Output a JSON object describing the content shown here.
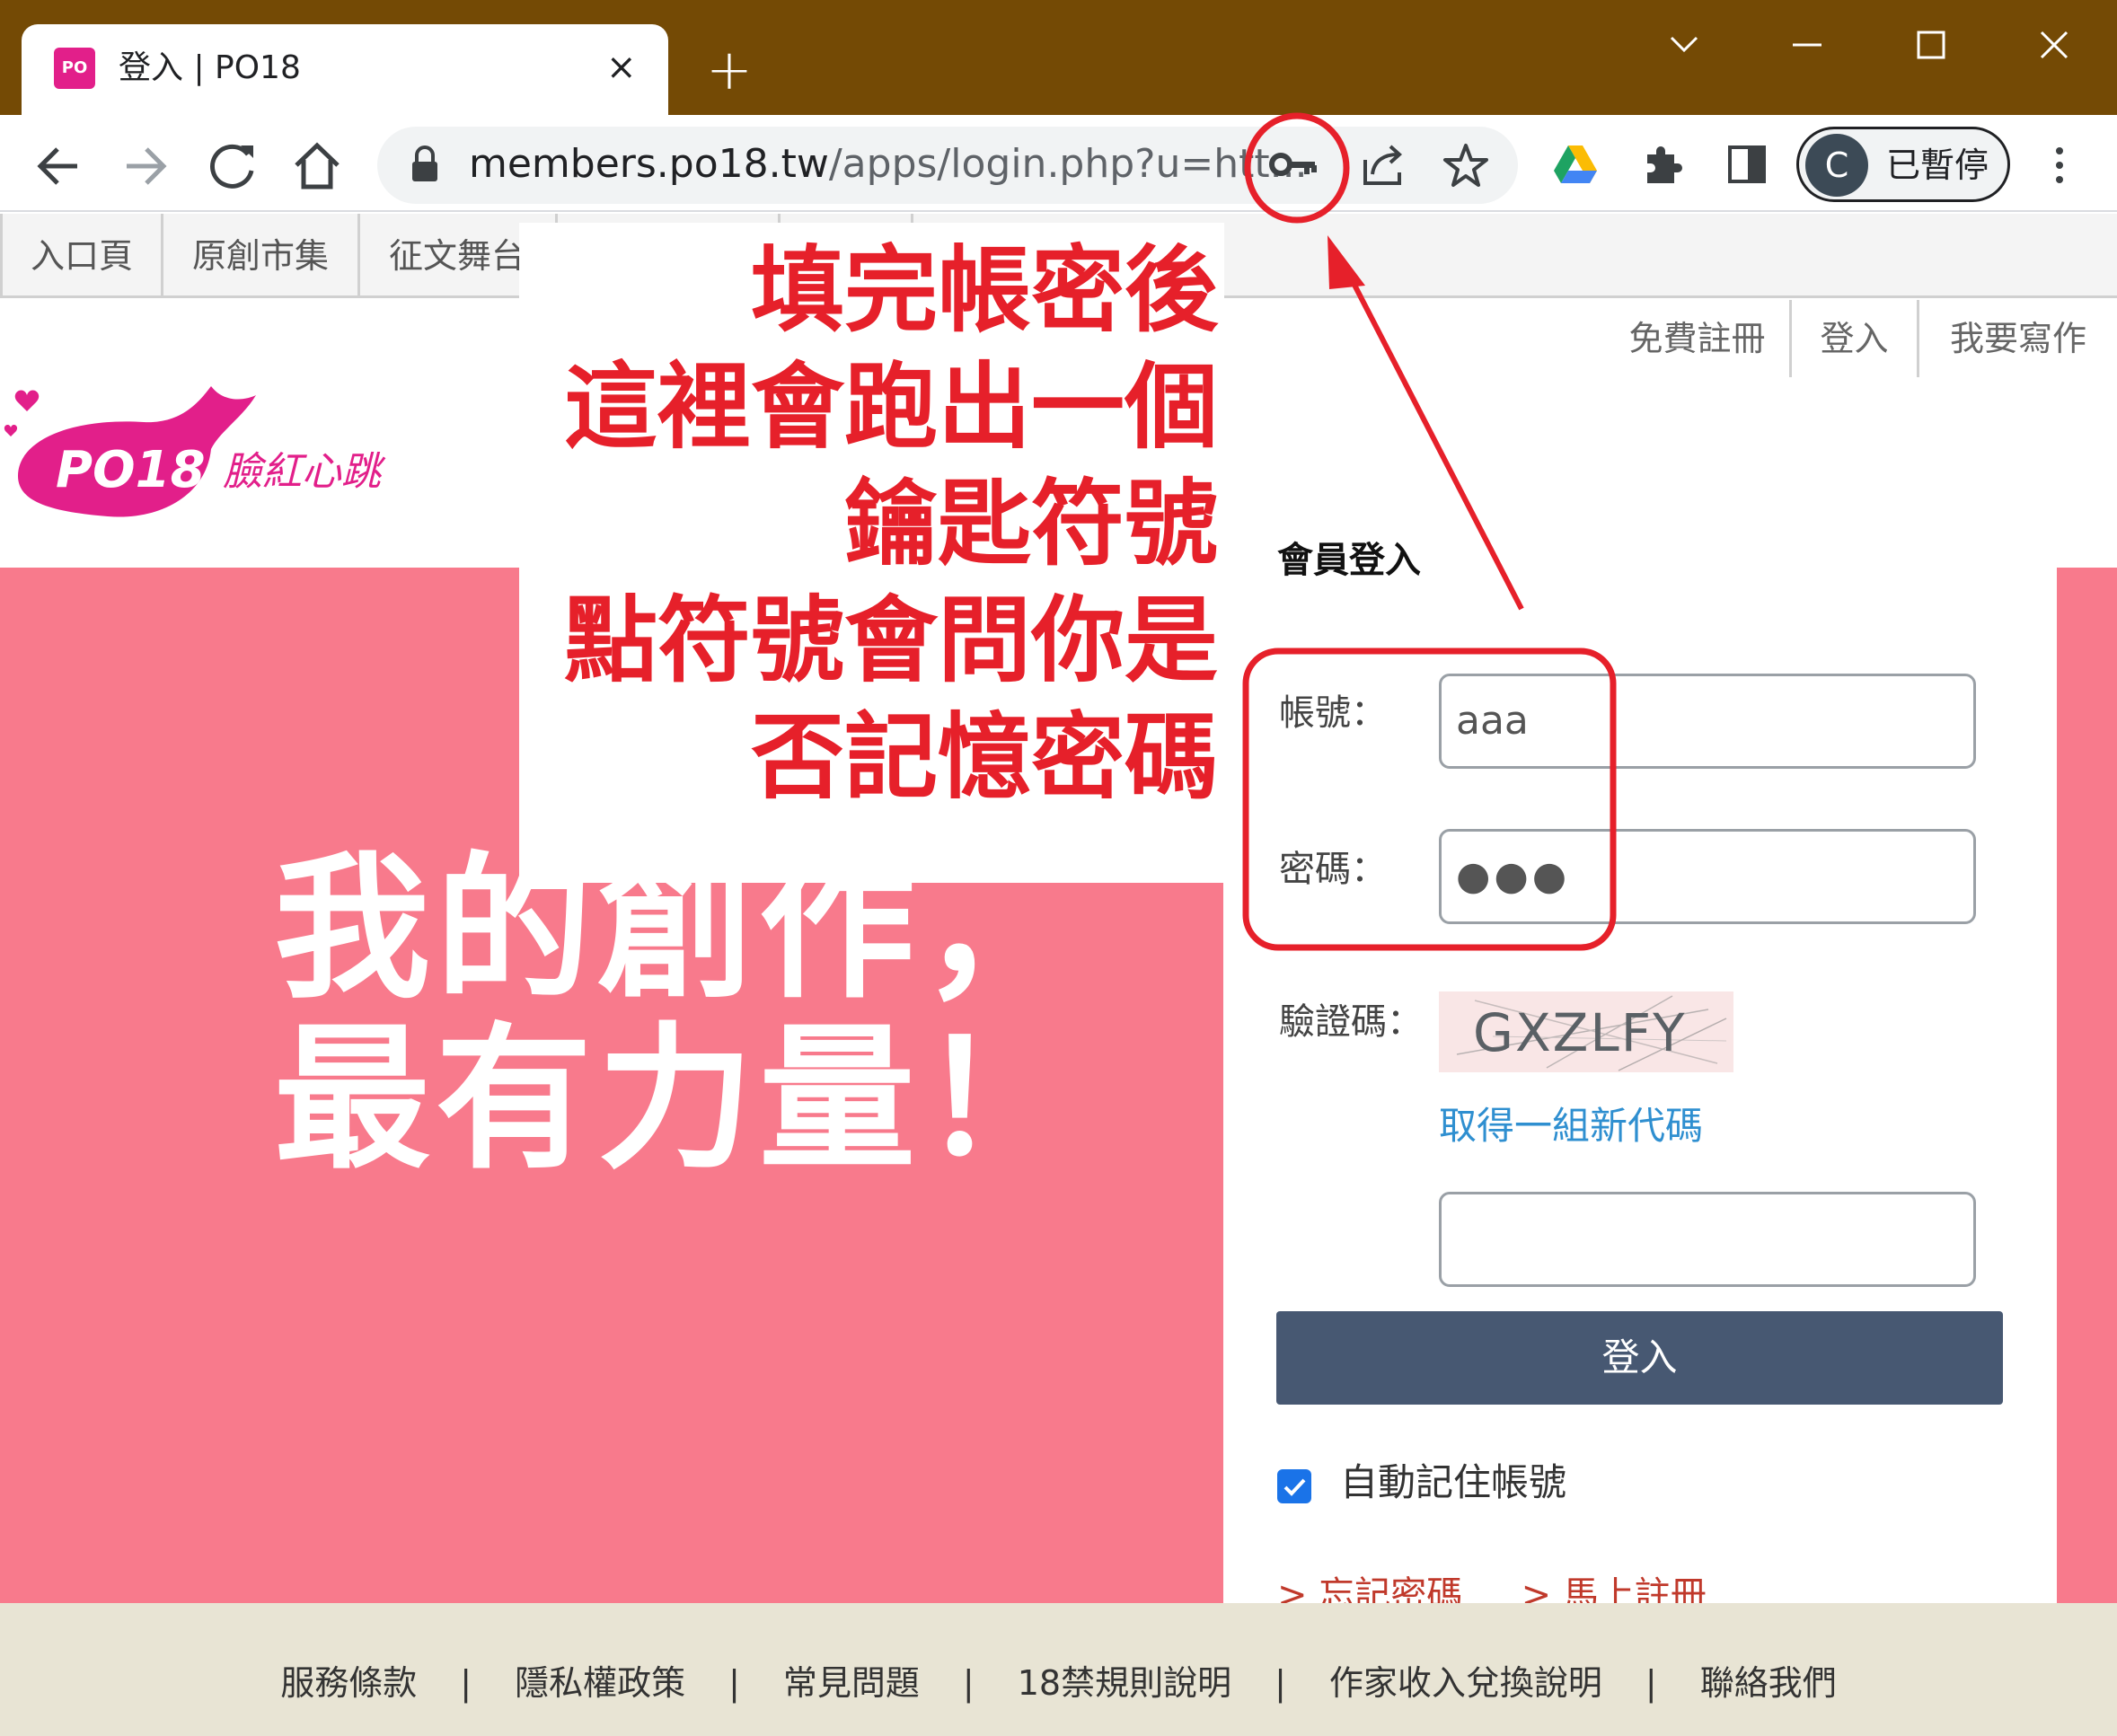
{
  "browser": {
    "tab_title": "登入 | PO18",
    "favicon_text": "PO",
    "tab_close": "×",
    "new_tab": "+",
    "url_host": "members.po18.tw",
    "url_rest": "/apps/login.php?u=htt...",
    "profile_initial": "C",
    "profile_status": "已暫停"
  },
  "site_nav": {
    "items": [
      {
        "label": "入口頁"
      },
      {
        "label": "原創市集"
      },
      {
        "label": "征文舞台"
      },
      {
        "label": ""
      },
      {
        "label": ""
      }
    ]
  },
  "header": {
    "register": "免費註冊",
    "login": "登入",
    "write": "我要寫作"
  },
  "logo": {
    "wordmark": "PO18",
    "tagline": "臉紅心跳"
  },
  "hero": {
    "line1": "我的創作，",
    "line2": "最有力量！"
  },
  "login_form": {
    "title": "會員登入",
    "account_label": "帳號：",
    "account_value": "aaa",
    "password_label": "密碼：",
    "password_value": "●●●",
    "captcha_label": "驗證碼：",
    "captcha_text": "GXZLFY",
    "new_code_link": "取得一組新代碼",
    "code_value": "",
    "submit": "登入",
    "remember_label": "自動記住帳號",
    "remember_checked": true,
    "forgot_link": "> 忘記密碼",
    "signup_link": "> 馬上註冊"
  },
  "footer": {
    "links": [
      "服務條款",
      "隱私權政策",
      "常見問題",
      "18禁規則說明",
      "作家收入兌換說明",
      "聯絡我們"
    ],
    "separator": "|"
  },
  "annotation": {
    "lines": [
      "填完帳密後",
      "這裡會跑出一個",
      "鑰匙符號",
      "點符號會問你是",
      "否記憶密碼"
    ],
    "color": "#e6202a"
  },
  "colors": {
    "titlebar": "#744a05",
    "hero": "#f87a8c",
    "button": "#475872",
    "link": "#2f8fd0",
    "footer": "#e8e4d4"
  }
}
